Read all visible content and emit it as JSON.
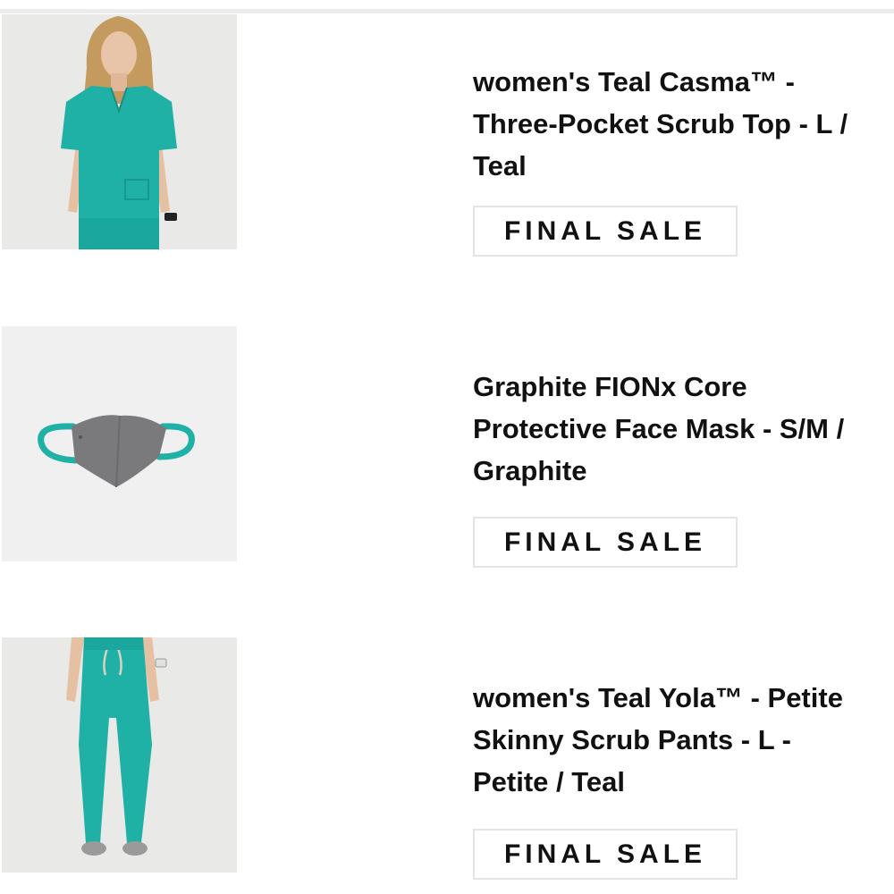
{
  "items": [
    {
      "title": "women's Teal Casma™ - Three-Pocket Scrub Top - L / Teal",
      "badge": "FINAL SALE",
      "image_icon": "scrub-top-image"
    },
    {
      "title": "Graphite FIONx Core Protective Face Mask - S/M / Graphite",
      "badge": "FINAL SALE",
      "image_icon": "face-mask-image"
    },
    {
      "title": "women's Teal Yola™ - Petite Skinny Scrub Pants - L - Petite / Teal",
      "badge": "FINAL SALE",
      "image_icon": "scrub-pants-image"
    }
  ],
  "colors": {
    "teal": "#1fb0a6",
    "graphite": "#7a7a7c",
    "text": "#111111",
    "badge_border": "#e4e4e4"
  }
}
